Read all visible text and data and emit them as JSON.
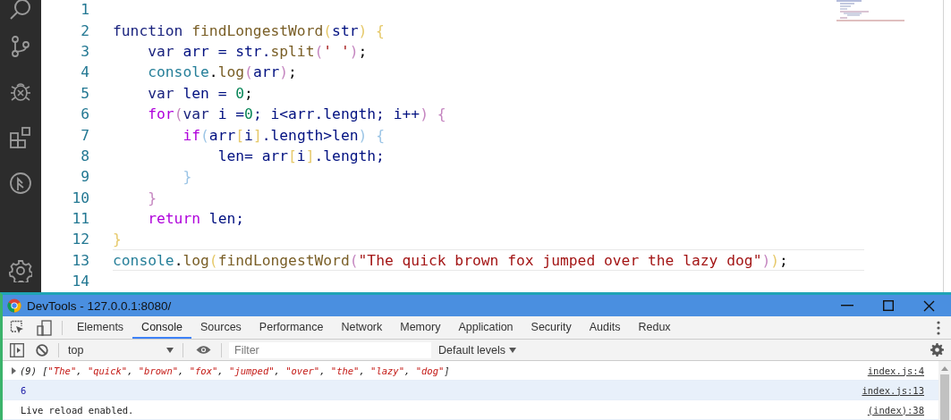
{
  "activity_bar": {
    "items": [
      {
        "kind": "search",
        "selected": false
      },
      {
        "kind": "source-control",
        "selected": false
      },
      {
        "kind": "debug",
        "selected": false
      },
      {
        "kind": "extensions",
        "selected": false
      },
      {
        "kind": "remote",
        "selected": false
      }
    ],
    "bottom": [
      {
        "kind": "settings"
      }
    ]
  },
  "editor": {
    "lines": [
      {
        "number": "1",
        "current": false
      },
      {
        "number": "2",
        "current": false,
        "tokens": [
          {
            "text": "function ",
            "kind": "keyword"
          },
          {
            "text": "findLongestWord",
            "kind": "function"
          },
          {
            "text": "(",
            "kind": "bracket1"
          },
          {
            "text": "str",
            "kind": "variable"
          },
          {
            "text": ") {",
            "kind": "bracket1"
          }
        ]
      },
      {
        "number": "3",
        "current": false,
        "tokens": [
          {
            "text": "    var",
            "kind": "keyword"
          },
          {
            "text": " arr = str.",
            "kind": "variable"
          },
          {
            "text": "split",
            "kind": "function"
          },
          {
            "text": "(",
            "kind": "bracket2"
          },
          {
            "text": "' '",
            "kind": "string"
          },
          {
            "text": ")",
            "kind": "bracket2"
          },
          {
            "text": ";",
            "kind": "plain"
          }
        ]
      },
      {
        "number": "4",
        "current": false,
        "tokens": [
          {
            "text": "    console",
            "kind": "builtin"
          },
          {
            "text": ".",
            "kind": "plain"
          },
          {
            "text": "log",
            "kind": "function"
          },
          {
            "text": "(",
            "kind": "bracket2"
          },
          {
            "text": "arr",
            "kind": "variable"
          },
          {
            "text": ")",
            "kind": "bracket2"
          },
          {
            "text": ";",
            "kind": "plain"
          }
        ]
      },
      {
        "number": "5",
        "current": false,
        "tokens": [
          {
            "text": "    var",
            "kind": "keyword"
          },
          {
            "text": " len = ",
            "kind": "variable"
          },
          {
            "text": "0",
            "kind": "number"
          },
          {
            "text": ";",
            "kind": "plain"
          }
        ]
      },
      {
        "number": "6",
        "current": false,
        "tokens": [
          {
            "text": "    for",
            "kind": "control"
          },
          {
            "text": "(",
            "kind": "bracket2"
          },
          {
            "text": "var",
            "kind": "keyword"
          },
          {
            "text": " i =",
            "kind": "variable"
          },
          {
            "text": "0",
            "kind": "number"
          },
          {
            "text": "; i<arr.length; i++",
            "kind": "variable"
          },
          {
            "text": ") {",
            "kind": "bracket2"
          }
        ]
      },
      {
        "number": "7",
        "current": false,
        "tokens": [
          {
            "text": "        if",
            "kind": "control"
          },
          {
            "text": "(",
            "kind": "bracket3"
          },
          {
            "text": "arr",
            "kind": "variable"
          },
          {
            "text": "[",
            "kind": "bracket1"
          },
          {
            "text": "i",
            "kind": "variable"
          },
          {
            "text": "]",
            "kind": "bracket1"
          },
          {
            "text": ".length>len",
            "kind": "variable"
          },
          {
            "text": ") {",
            "kind": "bracket3"
          }
        ]
      },
      {
        "number": "8",
        "current": false,
        "tokens": [
          {
            "text": "            len= arr",
            "kind": "variable"
          },
          {
            "text": "[",
            "kind": "bracket1"
          },
          {
            "text": "i",
            "kind": "variable"
          },
          {
            "text": "]",
            "kind": "bracket1"
          },
          {
            "text": ".length;",
            "kind": "variable"
          }
        ]
      },
      {
        "number": "9",
        "current": false,
        "tokens": [
          {
            "text": "        }",
            "kind": "bracket3"
          }
        ]
      },
      {
        "number": "10",
        "current": false,
        "tokens": [
          {
            "text": "    }",
            "kind": "bracket2"
          }
        ]
      },
      {
        "number": "11",
        "current": false,
        "tokens": [
          {
            "text": "    return",
            "kind": "control"
          },
          {
            "text": " len;",
            "kind": "variable"
          }
        ]
      },
      {
        "number": "12",
        "current": false,
        "tokens": [
          {
            "text": "}",
            "kind": "bracket1"
          }
        ]
      },
      {
        "number": "13",
        "current": true,
        "tokens": [
          {
            "text": "console",
            "kind": "builtin"
          },
          {
            "text": ".",
            "kind": "plain"
          },
          {
            "text": "log",
            "kind": "function"
          },
          {
            "text": "(",
            "kind": "bracket1"
          },
          {
            "text": "findLongestWord",
            "kind": "function"
          },
          {
            "text": "(",
            "kind": "bracket2"
          },
          {
            "text": "\"The quick brown fox jumped over the lazy dog\"",
            "kind": "string"
          },
          {
            "text": ")",
            "kind": "bracket2"
          },
          {
            "text": ")",
            "kind": "bracket1"
          },
          {
            "text": ";",
            "kind": "plain"
          }
        ]
      },
      {
        "number": "14",
        "current": false
      }
    ]
  },
  "devtools": {
    "title": "DevTools - 127.0.0.1:8080/",
    "tabs": [
      {
        "label": "Elements",
        "selected": false
      },
      {
        "label": "Console",
        "selected": true
      },
      {
        "label": "Sources",
        "selected": false
      },
      {
        "label": "Performance",
        "selected": false
      },
      {
        "label": "Network",
        "selected": false
      },
      {
        "label": "Memory",
        "selected": false
      },
      {
        "label": "Application",
        "selected": false
      },
      {
        "label": "Security",
        "selected": false
      },
      {
        "label": "Audits",
        "selected": false
      },
      {
        "label": "Redux",
        "selected": false
      }
    ],
    "context": "top",
    "filter": {
      "placeholder": "Filter"
    },
    "levels": "Default levels",
    "messages": [
      {
        "kind": "array",
        "expanded": false,
        "source": "index.js:4",
        "selected": false,
        "tokens": [
          {
            "text": "(9) [",
            "kind": "punct"
          },
          {
            "text": "\"The\"",
            "kind": "string"
          },
          {
            "text": ", ",
            "kind": "punct"
          },
          {
            "text": "\"quick\"",
            "kind": "string"
          },
          {
            "text": ", ",
            "kind": "punct"
          },
          {
            "text": "\"brown\"",
            "kind": "string"
          },
          {
            "text": ", ",
            "kind": "punct"
          },
          {
            "text": "\"fox\"",
            "kind": "string"
          },
          {
            "text": ", ",
            "kind": "punct"
          },
          {
            "text": "\"jumped\"",
            "kind": "string"
          },
          {
            "text": ", ",
            "kind": "punct"
          },
          {
            "text": "\"over\"",
            "kind": "string"
          },
          {
            "text": ", ",
            "kind": "punct"
          },
          {
            "text": "\"the\"",
            "kind": "string"
          },
          {
            "text": ", ",
            "kind": "punct"
          },
          {
            "text": "\"lazy\"",
            "kind": "string"
          },
          {
            "text": ", ",
            "kind": "punct"
          },
          {
            "text": "\"dog\"",
            "kind": "string"
          },
          {
            "text": "]",
            "kind": "punct"
          }
        ]
      },
      {
        "kind": "number",
        "text": "6",
        "source": "index.js:13",
        "selected": true
      },
      {
        "kind": "text",
        "text": "Live reload enabled.",
        "source": "(index):38",
        "selected": false
      }
    ]
  }
}
